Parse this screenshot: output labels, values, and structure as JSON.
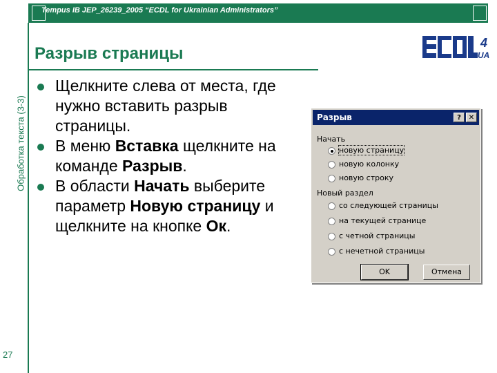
{
  "header": {
    "title": "Tempus IB JEP_26239_2005 “ECDL for Ukrainian Administrators”"
  },
  "side": {
    "vertical_label": "Обработка текста (3-3)",
    "slide_number": "27"
  },
  "slide": {
    "title": "Разрыв страницы"
  },
  "logo": {
    "text": "ECDL",
    "digit": "4",
    "ua": "UA"
  },
  "bullets": [
    {
      "parts": [
        {
          "t": "Щелкните слева от места, где нужно вставить разрыв страницы.",
          "b": false
        }
      ]
    },
    {
      "parts": [
        {
          "t": "В меню ",
          "b": false
        },
        {
          "t": "Вставка",
          "b": true
        },
        {
          "t": " щелкните на команде ",
          "b": false
        },
        {
          "t": "Разрыв",
          "b": true
        },
        {
          "t": ".",
          "b": false
        }
      ]
    },
    {
      "parts": [
        {
          "t": "В области ",
          "b": false
        },
        {
          "t": "Начать",
          "b": true
        },
        {
          "t": " выберите параметр ",
          "b": false
        },
        {
          "t": "Новую страницу",
          "b": true
        },
        {
          "t": " и щелкните на кнопке ",
          "b": false
        },
        {
          "t": "Ок",
          "b": true
        },
        {
          "t": ".",
          "b": false
        }
      ]
    }
  ],
  "dialog": {
    "title": "Разрыв",
    "help_glyph": "?",
    "close_glyph": "✕",
    "start_label": "Начать",
    "start_options": [
      "новую страницу",
      "новую колонку",
      "новую строку"
    ],
    "selected_start": 0,
    "section_label": "Новый раздел",
    "section_options": [
      "со следующей страницы",
      "на текущей странице",
      "с четной страницы",
      "с нечетной страницы"
    ],
    "ok_label": "OK",
    "cancel_label": "Отмена"
  },
  "colors": {
    "accent": "#1a7a52",
    "dialog_bg": "#d4d0c8",
    "titlebar": "#0a246a"
  }
}
